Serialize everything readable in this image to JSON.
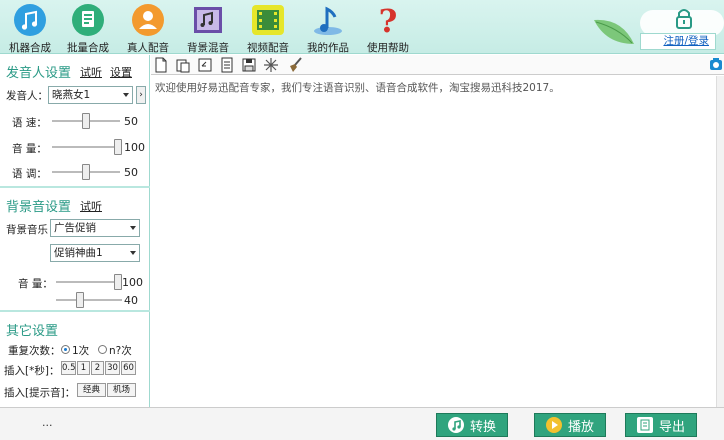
{
  "toolbar": {
    "items": [
      {
        "label": "机器合成",
        "icon": "music-note-icon"
      },
      {
        "label": "批量合成",
        "icon": "batch-document-icon"
      },
      {
        "label": "真人配音",
        "icon": "person-icon"
      },
      {
        "label": "背景混音",
        "icon": "music-mixer-icon"
      },
      {
        "label": "视频配音",
        "icon": "film-icon"
      },
      {
        "label": "我的作品",
        "icon": "music-file-icon"
      },
      {
        "label": "使用帮助",
        "icon": "question-icon"
      }
    ],
    "login_label": "注册/登录"
  },
  "voice_settings": {
    "title": "发音人设置",
    "audition_link": "试听",
    "settings_link": "设置",
    "speaker_label": "发音人：",
    "speaker_value": "晓燕女1",
    "speed_label": "语 速：",
    "speed_value": "50",
    "volume_label": "音 量：",
    "volume_value": "100",
    "pitch_label": "语 调：",
    "pitch_value": "50"
  },
  "bg_settings": {
    "title": "背景音设置",
    "audition_link": "试听",
    "music_label": "背景音乐",
    "music_category": "广告促销",
    "music_track": "促销神曲1",
    "volume_label": "音 量：",
    "volume_value": "100",
    "volume2_value": "40"
  },
  "other_settings": {
    "title": "其它设置",
    "repeat_label": "重复次数：",
    "repeat_option1": "1次",
    "repeat_option2": "n?次",
    "insert_sec_label": "插入[*秒]：",
    "insert_sec_options": [
      "0.5",
      "1",
      "2",
      "30",
      "60"
    ],
    "insert_tone_label": "插入[提示音]：",
    "insert_tone_options": [
      "经典",
      "机场"
    ]
  },
  "editor": {
    "text": "欢迎使用好易迅配音专家，我们专注语音识别、语音合成软件，淘宝搜易迅科技2017。"
  },
  "bottom": {
    "status": "...",
    "convert_label": "转换",
    "play_label": "播放",
    "export_label": "导出"
  },
  "colors": {
    "accent": "#2a9a86",
    "button": "#30a47e",
    "toolbar_bg": "#c6ece5"
  },
  "sliders": {
    "speed_fraction": 0.5,
    "volume_fraction": 1.0,
    "pitch_fraction": 0.5,
    "bg_volume_fraction": 1.0,
    "bg_volume2_fraction": 0.4
  }
}
